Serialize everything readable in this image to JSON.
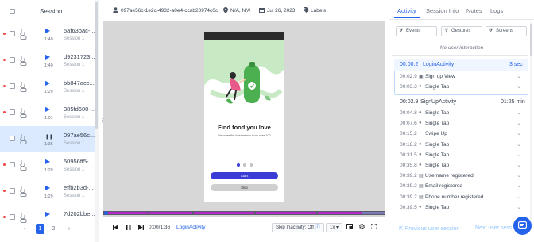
{
  "sessions_panel": {
    "header": "Session",
    "rows": [
      {
        "id": "5af63bac-...",
        "name": "Session 1",
        "duration": "1:40",
        "paused": false,
        "selected": false
      },
      {
        "id": "d9231723...",
        "name": "Session 1",
        "duration": "1:40",
        "paused": false,
        "selected": false
      },
      {
        "id": "bb847acc...",
        "name": "Session 1",
        "duration": "1:29",
        "paused": false,
        "selected": false
      },
      {
        "id": "385fd600-...",
        "name": "Session 1",
        "duration": "1:01",
        "paused": false,
        "selected": false
      },
      {
        "id": "097ae56c...",
        "name": "Session 1",
        "duration": "1:36",
        "paused": true,
        "selected": true
      },
      {
        "id": "50956ff5-...",
        "name": "Session 1",
        "duration": "1:29",
        "paused": false,
        "selected": false
      },
      {
        "id": "effb2b3d-...",
        "name": "Session 1",
        "duration": "1:29",
        "paused": false,
        "selected": false
      },
      {
        "id": "7d202bbe...",
        "name": "",
        "duration": "",
        "paused": false,
        "selected": false
      }
    ],
    "pager": {
      "prev": "‹",
      "pages": [
        "1",
        "2"
      ],
      "active_page": "1",
      "next": "›"
    }
  },
  "player_header": {
    "session_id": "097ae56c-1e2c-4932-a0e4-ccab20974c0c",
    "location": "N/A, N/A",
    "date": "Jul 26, 2023",
    "labels": "Labels"
  },
  "app_screen": {
    "title": "Find food you love",
    "subtitle": "Discover the best menus from over 100",
    "start_button": "Start",
    "skip_button": "Skip"
  },
  "playback": {
    "progress_fraction": 0.0,
    "time_display": "0:00/1:36",
    "current_activity": "LoginActivity",
    "skip_inactivity": "Skip Inactivity: Off",
    "speed": "1x"
  },
  "colors": {
    "accent": "#2563eb",
    "progress_track": "#5b5b6b",
    "marker": "#c026d3",
    "selected_row": "#dbeafe",
    "app_green": "#4caf50",
    "app_button": "#3b3bd6"
  },
  "side_panel": {
    "tabs": [
      "Activity",
      "Session Info",
      "Notes",
      "Logs"
    ],
    "active_tab": "Activity",
    "filters": [
      "Events",
      "Gestures",
      "Screens"
    ],
    "no_interaction": "No user interaction",
    "groups": [
      {
        "time": "00:00.2",
        "activity": "LoginActivity",
        "duration": "3 sec",
        "highlighted": true,
        "events": [
          {
            "time": "00:02.9",
            "icon": "view-icon",
            "label": "Sign up View"
          },
          {
            "time": "00:03.3",
            "icon": "tap-icon",
            "label": "Single Tap"
          }
        ]
      },
      {
        "time": "00:02.9",
        "activity": "SignUpActivity",
        "duration": "01:25 min",
        "highlighted": false,
        "events": [
          {
            "time": "00:04.8",
            "icon": "tap-icon",
            "label": "Single Tap"
          },
          {
            "time": "00:07.6",
            "icon": "tap-icon",
            "label": "Single Tap"
          },
          {
            "time": "00:15.2",
            "icon": "swipe-icon",
            "label": "Swipe Up"
          },
          {
            "time": "00:18.2",
            "icon": "tap-icon",
            "label": "Single Tap"
          },
          {
            "time": "00:31.5",
            "icon": "tap-icon",
            "label": "Single Tap"
          },
          {
            "time": "00:35.8",
            "icon": "tap-icon",
            "label": "Single Tap"
          },
          {
            "time": "00:39.2",
            "icon": "field-icon",
            "label": "Username registered"
          },
          {
            "time": "00:39.2",
            "icon": "field-icon",
            "label": "Email registered"
          },
          {
            "time": "00:39.2",
            "icon": "field-icon",
            "label": "Phone number registered"
          },
          {
            "time": "00:39.5",
            "icon": "tap-icon",
            "label": "Single Tap"
          }
        ]
      }
    ],
    "prev_session": "Previous user session",
    "next_session": "Next user sess"
  }
}
